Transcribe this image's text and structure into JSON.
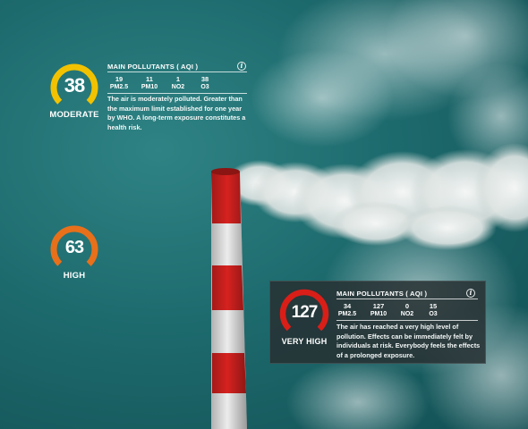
{
  "palette": {
    "moderate": "#f2c200",
    "high": "#e8701a",
    "very_high": "#d91e18",
    "track": "#4a5a5a",
    "sky": "#1d6a6d"
  },
  "gauges": {
    "moderate": {
      "value": "38",
      "level": "MODERATE",
      "fill_fraction": 0.19
    },
    "high": {
      "value": "63",
      "level": "HIGH",
      "fill_fraction": 0.31
    },
    "very_high": {
      "value": "127",
      "level": "VERY HIGH",
      "fill_fraction": 0.63
    }
  },
  "panels": {
    "moderate": {
      "title": "MAIN POLLUTANTS ( AQI )",
      "pollutants": [
        {
          "value": "19",
          "name": "PM2.5"
        },
        {
          "value": "11",
          "name": "PM10"
        },
        {
          "value": "1",
          "name": "NO2"
        },
        {
          "value": "38",
          "name": "O3"
        }
      ],
      "description_lines": [
        "The air is moderately polluted. Greater than",
        "the maximum limit established for one year",
        "by WHO. A long-term exposure constitutes a",
        "health risk."
      ]
    },
    "very_high": {
      "title": "MAIN POLLUTANTS ( AQI )",
      "pollutants": [
        {
          "value": "34",
          "name": "PM2.5"
        },
        {
          "value": "127",
          "name": "PM10"
        },
        {
          "value": "0",
          "name": "NO2"
        },
        {
          "value": "15",
          "name": "O3"
        }
      ],
      "description_lines": [
        "The air has reached a very high level of",
        "pollution. Effects can be immediately felt by",
        "individuals at risk. Everybody feels the effects",
        "of a prolonged exposure."
      ]
    }
  },
  "icons": {
    "info": "info-icon",
    "chimney": "smokestack-image"
  }
}
